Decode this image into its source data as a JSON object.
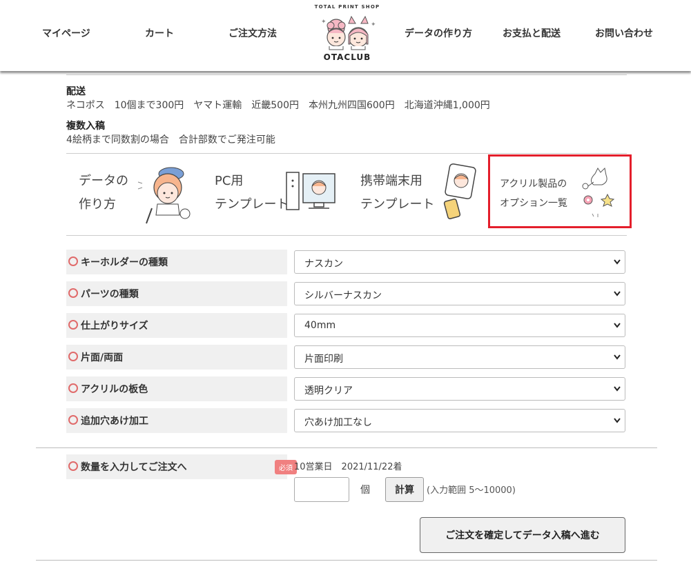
{
  "nav": {
    "mypage": "マイページ",
    "cart": "カート",
    "howto_order": "ご注文方法",
    "data_guide": "データの作り方",
    "payment": "お支払と配送",
    "contact": "お問い合わせ"
  },
  "logo": {
    "top": "TOTAL PRINT SHOP",
    "name": "OTACLUB"
  },
  "info": {
    "shipping_title": "配送",
    "shipping_text": "ネコポス　10個まで300円　ヤマト運輸　近畿500円　本州九州四国600円　北海道沖縄1,000円",
    "multi_title": "複数入稿",
    "multi_text": "4絵柄まで同数割の場合　合計部数でご発注可能"
  },
  "banners": {
    "data_line1": "データの",
    "data_line2": "作り方",
    "pc_line1": "PC用",
    "pc_line2": "テンプレート",
    "mobile_line1": "携帯端末用",
    "mobile_line2": "テンプレート",
    "acrylic_line1": "アクリル製品の",
    "acrylic_line2": "オプション一覧"
  },
  "options": [
    {
      "label": "キーホルダーの種類",
      "value": "ナスカン"
    },
    {
      "label": "パーツの種類",
      "value": "シルバーナスカン"
    },
    {
      "label": "仕上がりサイズ",
      "value": "40mm"
    },
    {
      "label": "片面/両面",
      "value": "片面印刷"
    },
    {
      "label": "アクリルの板色",
      "value": "透明クリア"
    },
    {
      "label": "追加穴あけ加工",
      "value": "穴あけ加工なし"
    }
  ],
  "order": {
    "quantity_label": "数量を入力してご注文へ",
    "required_badge": "必須",
    "delivery": "10営業日　2021/11/22着",
    "quantity_value": "",
    "unit": "個",
    "calc_button": "計算",
    "range_note": "(入力範囲 5～10000)",
    "confirm_button": "ご注文を確定してデータ入稿へ進む"
  },
  "colors": {
    "highlight": "#e41e2b",
    "required_badge": "#f08080",
    "option_marker": "#e06a6a"
  }
}
